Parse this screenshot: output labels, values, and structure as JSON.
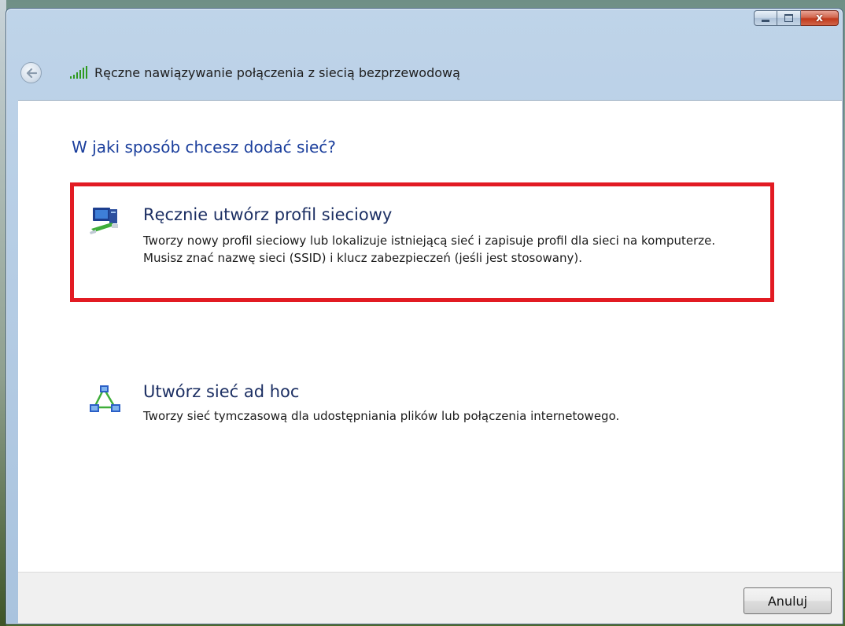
{
  "window": {
    "nav_title": "Ręczne nawiązywanie połączenia z siecią bezprzewodową",
    "caption_buttons": {
      "minimize_icon": "minimize-icon",
      "maximize_icon": "maximize-icon",
      "close_icon": "close-icon",
      "close_glyph": "x"
    }
  },
  "main": {
    "heading": "W jaki sposób chcesz dodać sieć?",
    "options": [
      {
        "icon": "network-profile-icon",
        "title": "Ręcznie utwórz profil sieciowy",
        "description": "Tworzy nowy profil sieciowy lub lokalizuje istniejącą sieć i zapisuje profil dla sieci na komputerze. Musisz znać nazwę sieci (SSID) i klucz zabezpieczeń (jeśli jest stosowany).",
        "highlighted": true
      },
      {
        "icon": "ad-hoc-network-icon",
        "title": "Utwórz sieć ad hoc",
        "description": "Tworzy sieć tymczasową dla  udostępniania plików lub połączenia internetowego.",
        "highlighted": false
      }
    ]
  },
  "footer": {
    "cancel_label": "Anuluj"
  },
  "colors": {
    "heading": "#1a3e9c",
    "highlight_border": "#e21b23",
    "close_button": "#c1391c"
  }
}
